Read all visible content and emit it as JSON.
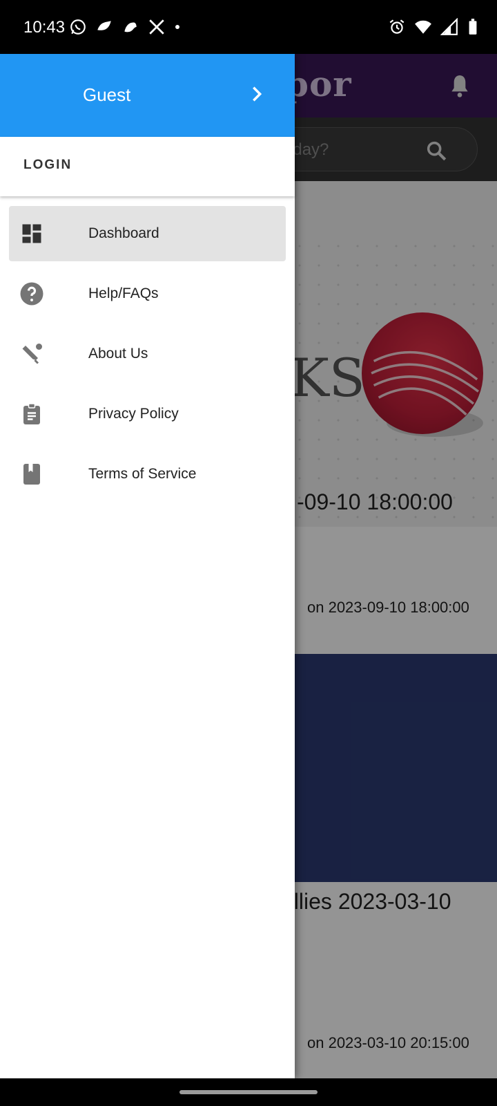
{
  "status_bar": {
    "time": "10:43",
    "left_icons": [
      "whatsapp-icon",
      "app-icon",
      "bird-icon",
      "x-icon",
      "dot-icon"
    ],
    "right_icons": [
      "alarm-icon",
      "wifi-icon",
      "signal-icon",
      "battery-icon"
    ]
  },
  "background": {
    "logo": "por",
    "search_placeholder": "oday?",
    "card1": {
      "image_text": "KS",
      "title": "-09-10 18:00:00",
      "meta": "on 2023-09-10 18:00:00"
    },
    "card2": {
      "title": "allies 2023-03-10",
      "meta": "on 2023-03-10 20:15:00"
    }
  },
  "drawer": {
    "header": {
      "name": "Guest",
      "color": "#2196f3"
    },
    "login_label": "LOGIN",
    "items": [
      {
        "label": "Dashboard",
        "icon": "dashboard-icon",
        "selected": true
      },
      {
        "label": "Help/FAQs",
        "icon": "help-icon",
        "selected": false
      },
      {
        "label": "About Us",
        "icon": "cricket-icon",
        "selected": false
      },
      {
        "label": "Privacy Policy",
        "icon": "clipboard-icon",
        "selected": false
      },
      {
        "label": "Terms of Service",
        "icon": "book-icon",
        "selected": false
      }
    ]
  }
}
